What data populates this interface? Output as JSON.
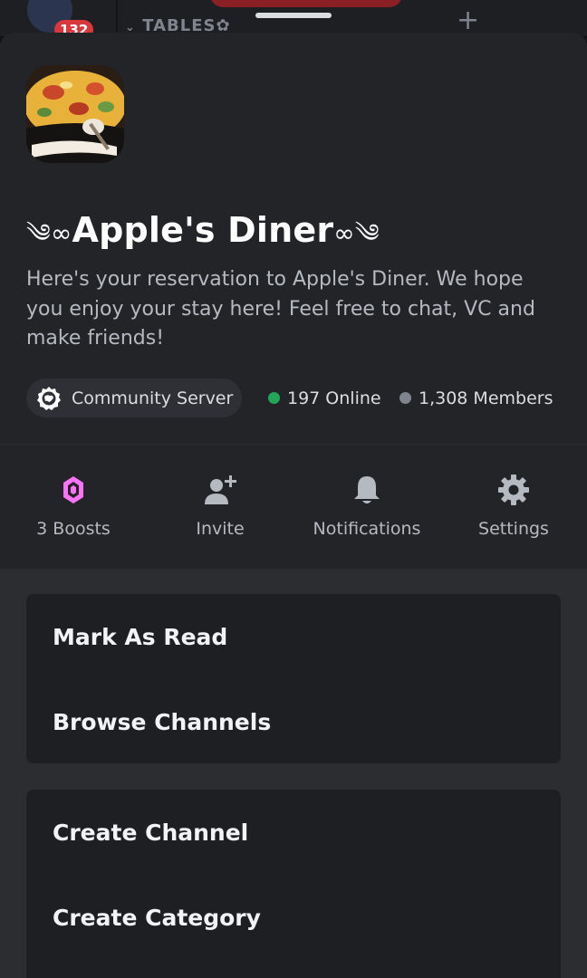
{
  "background": {
    "badge_count": "132",
    "category_label": "TABLES✿"
  },
  "server": {
    "name": "༄ఌ‍Apple's Diner✿ఌ",
    "name_display": "༄∞Apple's Diner∞༄",
    "description": "Here's your reservation to Apple's Diner. We hope you enjoy your stay here! Feel free to chat, VC and make friends!",
    "community_label": "Community Server",
    "online_text": "197 Online",
    "members_text": "1,308 Members",
    "online_color": "#23a55a",
    "members_color": "#80848e"
  },
  "actions": [
    {
      "label": "3 Boosts",
      "icon": "boost-gem-icon",
      "color": "#ff73fa"
    },
    {
      "label": "Invite",
      "icon": "add-user-icon",
      "color": "#b5bac1"
    },
    {
      "label": "Notifications",
      "icon": "bell-icon",
      "color": "#b5bac1"
    },
    {
      "label": "Settings",
      "icon": "gear-icon",
      "color": "#b5bac1"
    }
  ],
  "menu": {
    "group1": [
      "Mark As Read",
      "Browse Channels"
    ],
    "group2": [
      "Create Channel",
      "Create Category"
    ]
  }
}
